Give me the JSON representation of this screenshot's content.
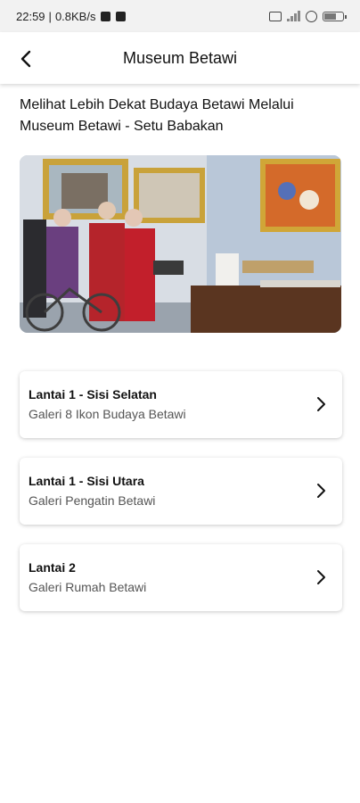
{
  "status_bar": {
    "time": "22:59",
    "network_speed": "0.8KB/s",
    "battery_level": 0.6
  },
  "app_bar": {
    "title": "Museum Betawi"
  },
  "headline": "Melihat Lebih Dekat Budaya Betawi Melalui Museum Betawi - Setu Babakan",
  "galleries": [
    {
      "title": "Lantai 1 - Sisi Selatan",
      "subtitle": "Galeri 8 Ikon Budaya Betawi"
    },
    {
      "title": "Lantai 1 - Sisi Utara",
      "subtitle": "Galeri Pengatin Betawi"
    },
    {
      "title": "Lantai 2",
      "subtitle": "Galeri Rumah Betawi"
    }
  ],
  "icons": {
    "back": "arrow-left-icon",
    "chevron": "chevron-right-icon"
  }
}
